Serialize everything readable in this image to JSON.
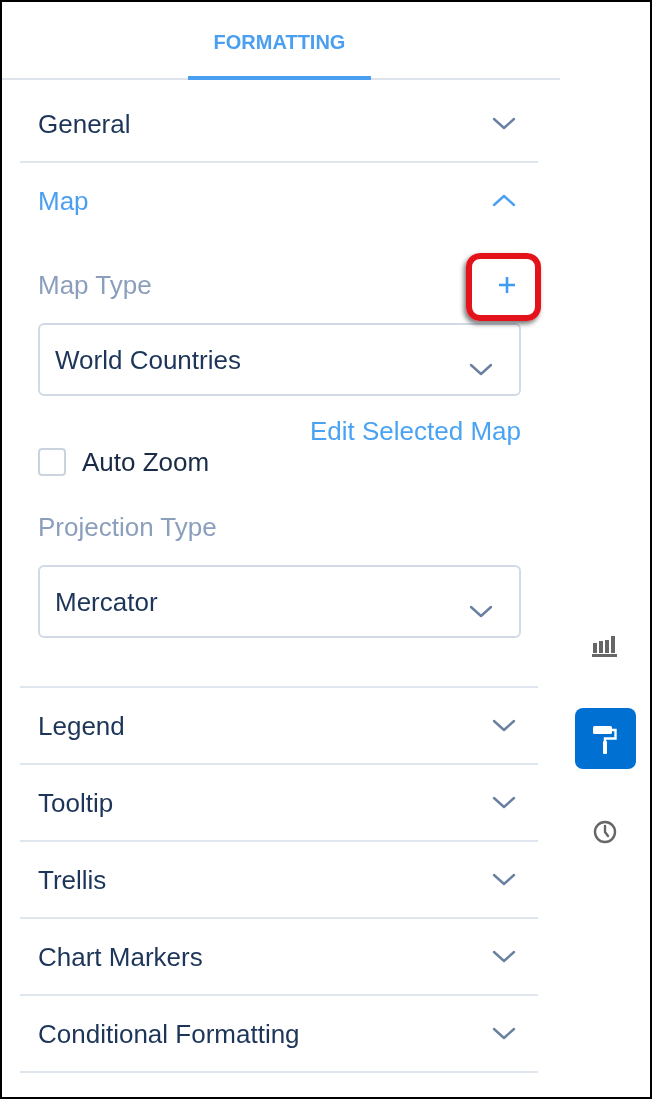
{
  "tabs": [
    {
      "label": "FORMATTING",
      "selected": true
    }
  ],
  "sections": [
    {
      "title": "General",
      "expanded": false
    },
    {
      "title": "Map",
      "expanded": true,
      "fields": [
        {
          "kind": "select",
          "label": "Map Type",
          "value": "World Countries",
          "add_button": {
            "highlighted": true
          }
        },
        {
          "kind": "link",
          "label": "Edit Selected Map"
        },
        {
          "kind": "checkbox",
          "label": "Auto Zoom",
          "checked": false
        },
        {
          "kind": "select",
          "label": "Projection Type",
          "value": "Mercator"
        }
      ]
    },
    {
      "title": "Legend",
      "expanded": false
    },
    {
      "title": "Tooltip",
      "expanded": false
    },
    {
      "title": "Trellis",
      "expanded": false
    },
    {
      "title": "Chart Markers",
      "expanded": false
    },
    {
      "title": "Conditional Formatting",
      "expanded": false
    }
  ],
  "rail": [
    {
      "kind": "chart",
      "selected": false
    },
    {
      "kind": "paint",
      "selected": true
    },
    {
      "kind": "clock",
      "selected": false
    }
  ]
}
